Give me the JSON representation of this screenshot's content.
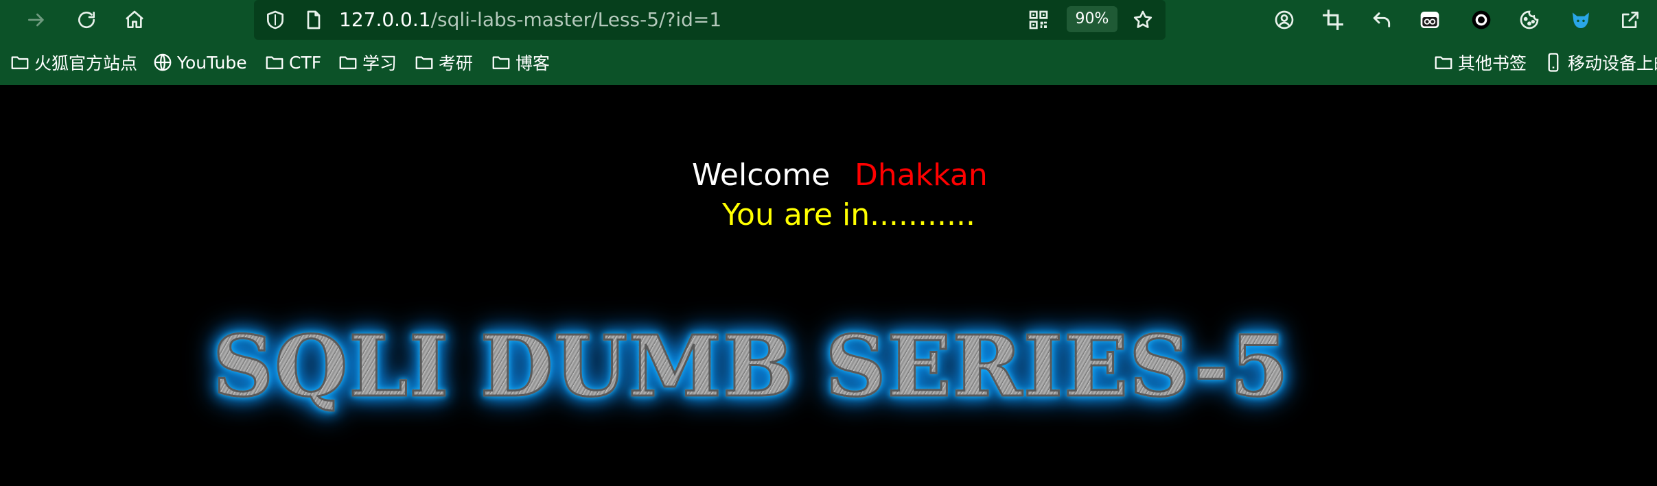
{
  "browser": {
    "url_host": "127.0.0.1",
    "url_path": "/sqli-labs-master/Less-5/?id=1",
    "zoom_label": "90%",
    "icons": {
      "forward": "forward-arrow-icon",
      "reload": "reload-icon",
      "home": "home-icon",
      "shield": "tracking-shield-icon",
      "page": "page-info-icon",
      "qr": "qr-code-icon",
      "star": "bookmark-star-icon",
      "account": "account-icon",
      "crop": "screenshot-crop-icon",
      "back_arrow": "undo-arrow-icon",
      "ext1": "extension-mask-icon",
      "ext2": "extension-circle-icon",
      "ext3": "cookie-icon",
      "ext4": "fox-extension-icon",
      "ext5": "share-icon"
    }
  },
  "bookmarks": {
    "items": [
      {
        "label": "火狐官方站点",
        "icon": "folder-icon"
      },
      {
        "label": "YouTube",
        "icon": "globe-icon"
      },
      {
        "label": "CTF",
        "icon": "folder-icon"
      },
      {
        "label": "学习",
        "icon": "folder-icon"
      },
      {
        "label": "考研",
        "icon": "folder-icon"
      },
      {
        "label": "博客",
        "icon": "folder-icon"
      }
    ],
    "other_label": "其他书签",
    "mobile_label": "移动设备上的"
  },
  "page": {
    "welcome_word": "Welcome",
    "welcome_name": "Dhakkan",
    "status_text": "You are in...........",
    "banner_text": "SQLI DUMB SERIES-5"
  },
  "colors": {
    "toolbar_bg": "#0c5228",
    "urlbar_bg": "#063f1c",
    "page_bg": "#000000",
    "welcome": "#ffffff",
    "name": "#ff0000",
    "status": "#ffff00",
    "banner_glow": "#18b4ff"
  }
}
